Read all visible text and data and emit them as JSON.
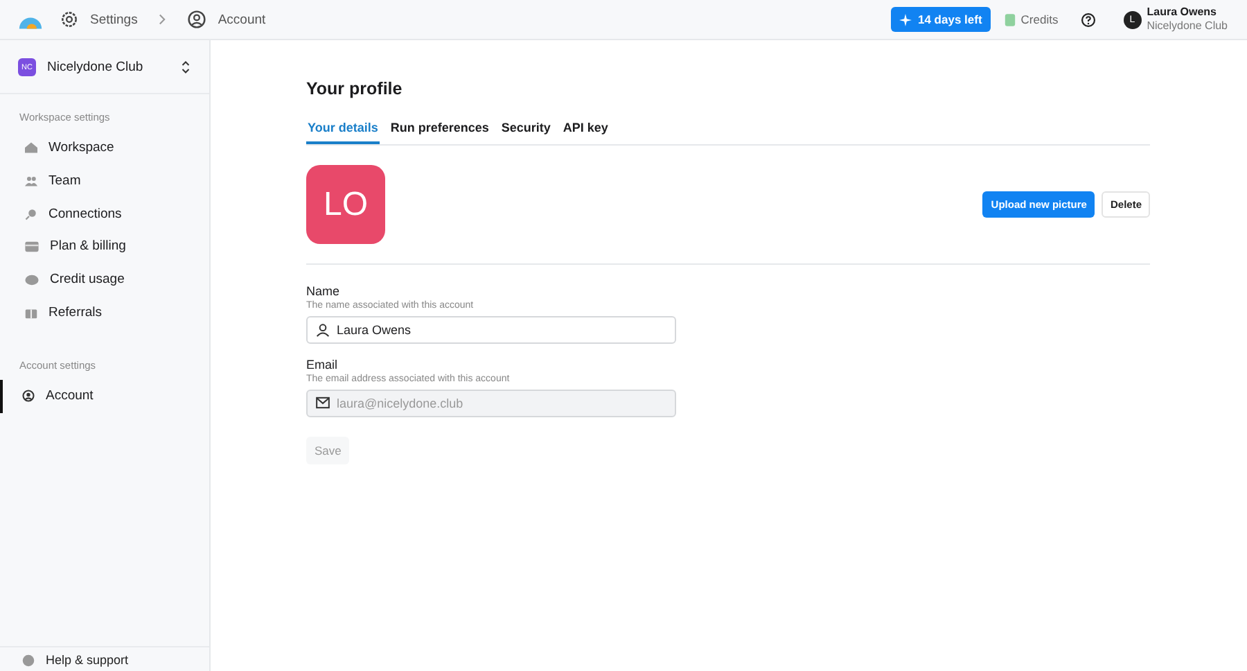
{
  "topbar": {
    "breadcrumbs": [
      {
        "label": "Settings"
      },
      {
        "label": "Account"
      }
    ],
    "trial_badge": "14 days left",
    "credits": "Credits",
    "user": {
      "initial": "L",
      "name": "Laura Owens",
      "org": "Nicelydone Club"
    }
  },
  "sidebar": {
    "workspace": {
      "initials": "NC",
      "name": "Nicelydone Club"
    },
    "sections": [
      {
        "heading": "Workspace settings",
        "items": [
          {
            "label": "Workspace",
            "selected": false
          },
          {
            "label": "Team",
            "selected": false
          },
          {
            "label": "Connections",
            "selected": false
          },
          {
            "label": "Plan & billing",
            "selected": false
          },
          {
            "label": "Credit usage",
            "selected": false
          },
          {
            "label": "Referrals",
            "selected": false
          }
        ]
      },
      {
        "heading": "Account settings",
        "items": [
          {
            "label": "Account",
            "selected": true
          }
        ]
      }
    ],
    "footer": "Help & support"
  },
  "main": {
    "title": "Your profile",
    "tabs": [
      {
        "label": "Your details",
        "selected": true
      },
      {
        "label": "Run preferences",
        "selected": false
      },
      {
        "label": "Security",
        "selected": false
      },
      {
        "label": "API key",
        "selected": false
      }
    ],
    "avatar": {
      "initials": "LO"
    },
    "upload_button": "Upload new picture",
    "delete_button": "Delete",
    "fields": [
      {
        "kind": "user",
        "label": "Name",
        "hint": "The name associated with this account",
        "value": "Laura Owens",
        "disabled": false
      },
      {
        "kind": "mail",
        "label": "Email",
        "hint": "The email address associated with this account",
        "value": "laura@nicelydone.club",
        "disabled": true
      }
    ],
    "save_button": {
      "label": "Save",
      "disabled": true
    }
  }
}
